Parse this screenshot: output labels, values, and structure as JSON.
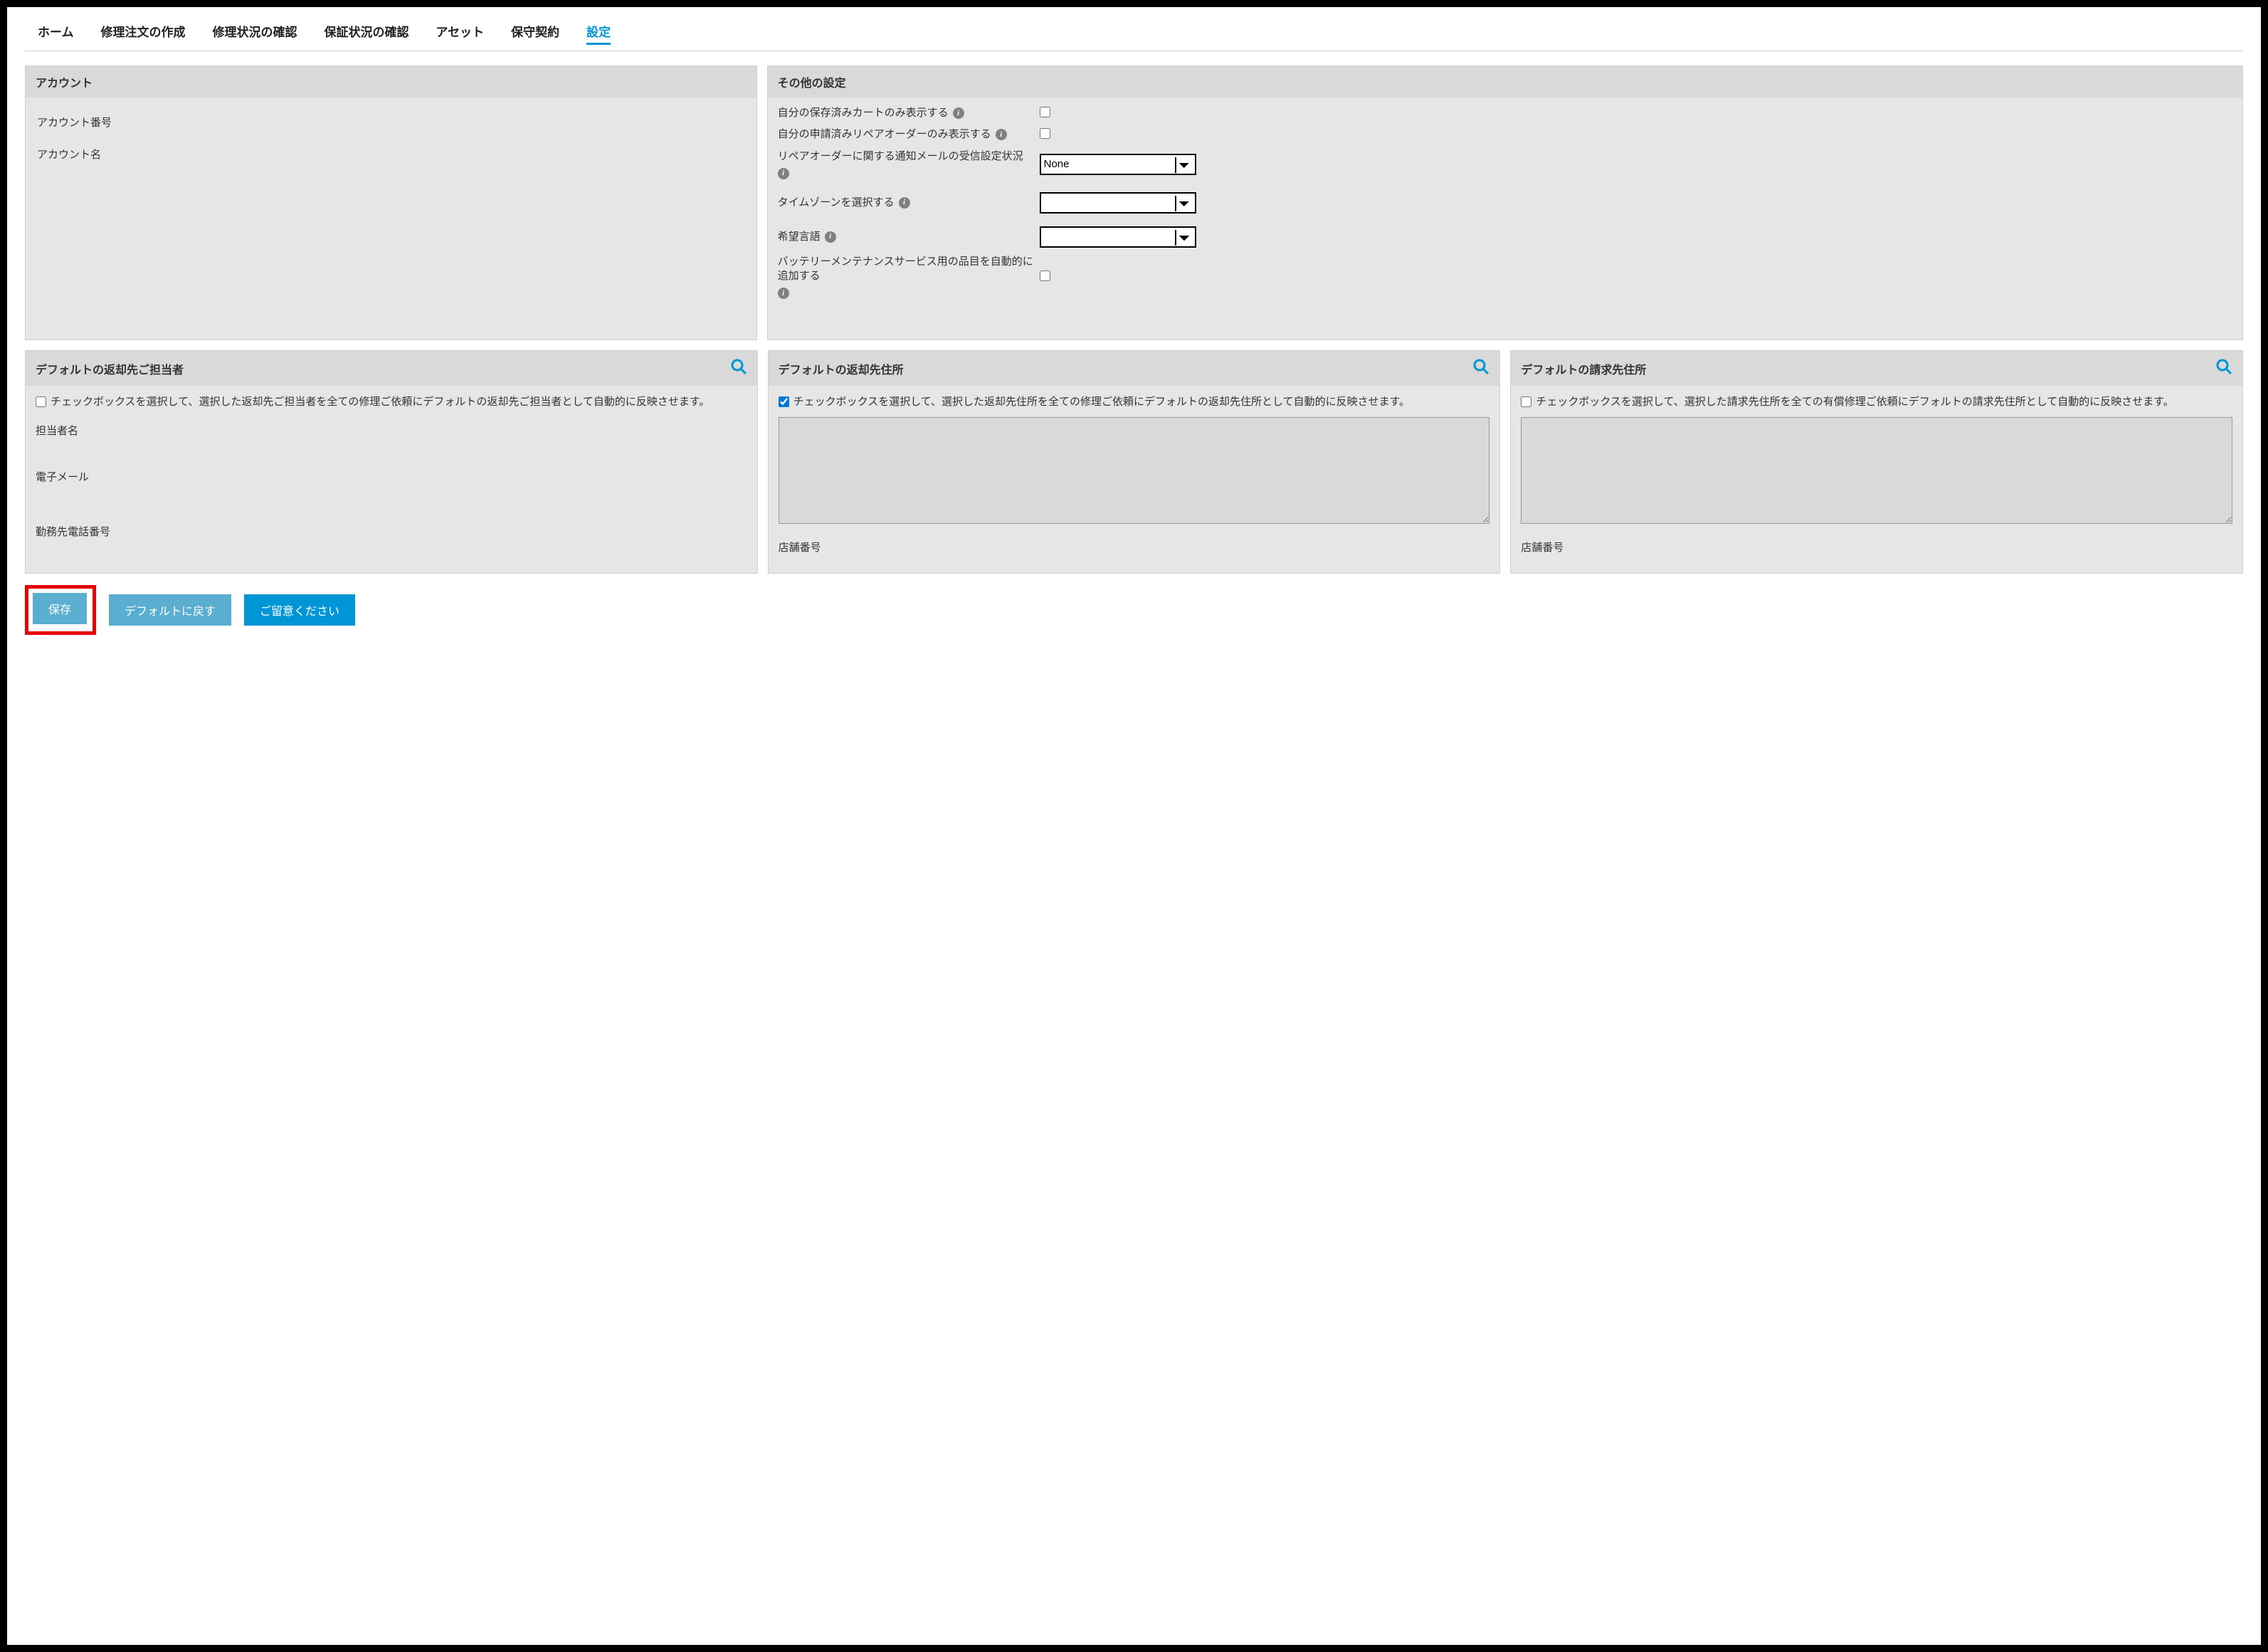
{
  "tabs": {
    "home": "ホーム",
    "create_repair": "修理注文の作成",
    "repair_status": "修理状況の確認",
    "warranty_status": "保証状況の確認",
    "asset": "アセット",
    "maintenance": "保守契約",
    "settings": "設定"
  },
  "account_panel": {
    "title": "アカウント",
    "account_number_label": "アカウント番号",
    "account_name_label": "アカウント名"
  },
  "other_panel": {
    "title": "その他の設定",
    "saved_cart_only_label": "自分の保存済みカートのみ表示する",
    "submitted_repair_only_label": "自分の申請済みリペアオーダーのみ表示する",
    "notification_label": "リペアオーダーに関する通知メールの受信設定状況",
    "notification_value": "None",
    "timezone_label": "タイムゾーンを選択する",
    "timezone_value": "",
    "language_label": "希望言語",
    "language_value": "",
    "battery_auto_label": "バッテリーメンテナンスサービス用の品目を自動的に追加する",
    "saved_cart_only_checked": false,
    "submitted_repair_only_checked": false,
    "battery_auto_checked": false
  },
  "default_contact_panel": {
    "title": "デフォルトの返却先ご担当者",
    "checkbox_text": "チェックボックスを選択して、選択した返却先ご担当者を全ての修理ご依頼にデフォルトの返却先ご担当者として自動的に反映させます。",
    "checked": false,
    "contact_name_label": "担当者名",
    "email_label": "電子メール",
    "work_phone_label": "勤務先電話番号"
  },
  "default_return_addr_panel": {
    "title": "デフォルトの返却先住所",
    "checkbox_text": "チェックボックスを選択して、選択した返却先住所を全ての修理ご依頼にデフォルトの返却先住所として自動的に反映させます。",
    "checked": true,
    "address_value": "",
    "store_number_label": "店舗番号"
  },
  "default_billing_addr_panel": {
    "title": "デフォルトの請求先住所",
    "checkbox_text": "チェックボックスを選択して、選択した請求先住所を全ての有償修理ご依頼にデフォルトの請求先住所として自動的に反映させます。",
    "checked": false,
    "address_value": "",
    "store_number_label": "店舗番号"
  },
  "buttons": {
    "save": "保存",
    "reset": "デフォルトに戻す",
    "note": "ご留意ください"
  }
}
